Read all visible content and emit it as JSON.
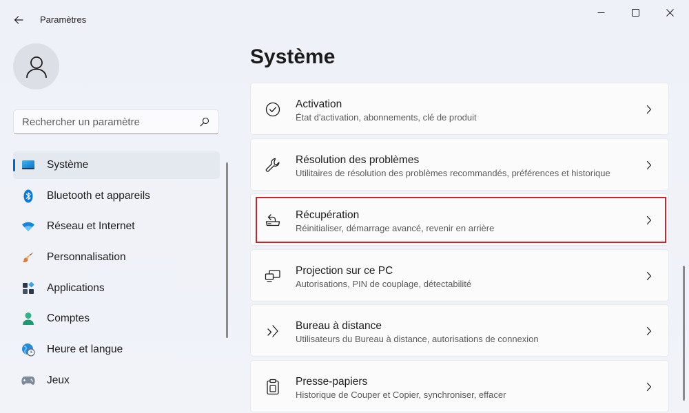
{
  "window": {
    "title": "Paramètres",
    "controls": [
      "minimize",
      "maximize",
      "close"
    ]
  },
  "sidebar": {
    "search_placeholder": "Rechercher un paramètre",
    "items": [
      {
        "label": "Système",
        "icon": "monitor-icon",
        "active": true
      },
      {
        "label": "Bluetooth et appareils",
        "icon": "bluetooth-icon",
        "active": false
      },
      {
        "label": "Réseau et Internet",
        "icon": "wifi-icon",
        "active": false
      },
      {
        "label": "Personnalisation",
        "icon": "brush-icon",
        "active": false
      },
      {
        "label": "Applications",
        "icon": "apps-icon",
        "active": false
      },
      {
        "label": "Comptes",
        "icon": "account-icon",
        "active": false
      },
      {
        "label": "Heure et langue",
        "icon": "globe-clock-icon",
        "active": false
      },
      {
        "label": "Jeux",
        "icon": "gamepad-icon",
        "active": false
      }
    ]
  },
  "main": {
    "title": "Système",
    "cards": [
      {
        "title": "Activation",
        "subtitle": "État d'activation, abonnements, clé de produit",
        "icon": "check-circle-icon"
      },
      {
        "title": "Résolution des problèmes",
        "subtitle": "Utilitaires de résolution des problèmes recommandés, préférences et historique",
        "icon": "wrench-icon"
      },
      {
        "title": "Récupération",
        "subtitle": "Réinitialiser, démarrage avancé, revenir en arrière",
        "icon": "recovery-icon",
        "highlighted": true
      },
      {
        "title": "Projection sur ce PC",
        "subtitle": "Autorisations, PIN de couplage, détectabilité",
        "icon": "projection-icon"
      },
      {
        "title": "Bureau à distance",
        "subtitle": "Utilisateurs du Bureau à distance, autorisations de connexion",
        "icon": "remote-desktop-icon"
      },
      {
        "title": "Presse-papiers",
        "subtitle": "Historique de Couper et Copier, synchroniser, effacer",
        "icon": "clipboard-icon"
      }
    ]
  },
  "colors": {
    "accent": "#0067c0",
    "highlight_border": "#d0202a",
    "background": "#eef2f9",
    "card": "#fbfbfc"
  }
}
